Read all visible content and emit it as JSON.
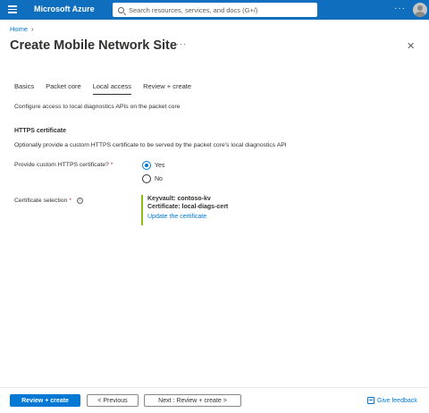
{
  "topbar": {
    "brand": "Microsoft Azure",
    "search_placeholder": "Search resources, services, and docs (G+/)",
    "more": "···",
    "color": "#106ebe"
  },
  "breadcrumb": {
    "home": "Home",
    "chevron": "›"
  },
  "header": {
    "title": "Create Mobile Network Site",
    "more": "···",
    "close": "✕"
  },
  "tabs": [
    {
      "label": "Basics"
    },
    {
      "label": "Packet core"
    },
    {
      "label": "Local access",
      "active": true
    },
    {
      "label": "Review + create"
    }
  ],
  "main": {
    "description": "Configure access to local diagnostics APIs on the packet core",
    "section_title": "HTTPS certificate",
    "section_desc": "Optionally provide a custom HTTPS certificate to be served by the packet core's local diagnostics API",
    "custom_cert_label": "Provide custom HTTPS certificate?",
    "required_mark": "*",
    "options": [
      "Yes",
      "No"
    ],
    "selected_option": "Yes",
    "cert_selection_label": "Certificate selection",
    "info_glyph": "i",
    "keyvault": "Keyvault: contoso-kv",
    "certificate": "Certificate: local-diags-cert",
    "update_link": "Update the certificate",
    "accent_color": "#8cbd18"
  },
  "footer": {
    "review_create": "Review + create",
    "previous": "< Previous",
    "next": "Next : Review + create >",
    "feedback": "Give feedback"
  }
}
